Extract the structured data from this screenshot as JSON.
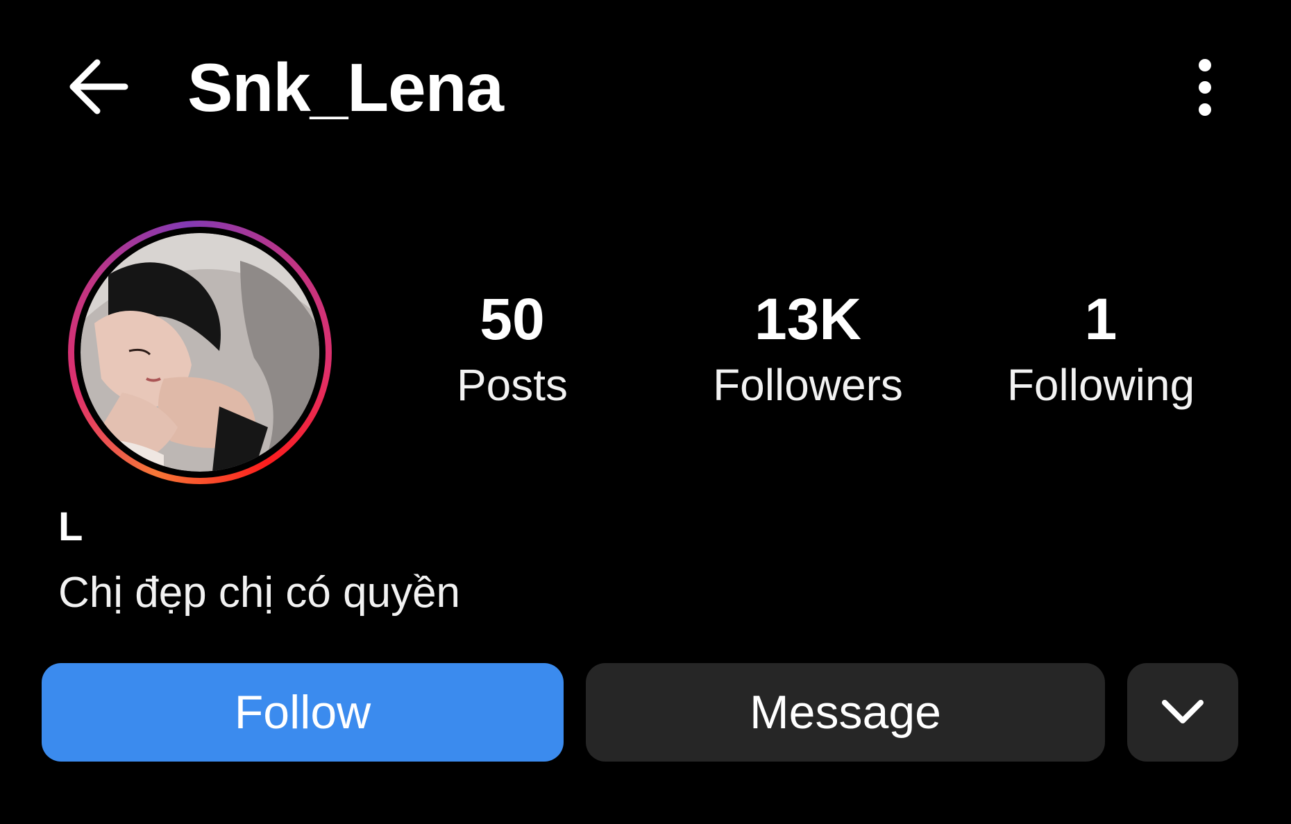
{
  "header": {
    "back_icon": "arrow-left-icon",
    "username": "Snk_Lena",
    "more_icon": "vertical-ellipsis-icon"
  },
  "profile": {
    "avatar_icon": "profile-photo",
    "stats": [
      {
        "value": "50",
        "label": "Posts"
      },
      {
        "value": "13K",
        "label": "Followers"
      },
      {
        "value": "1",
        "label": "Following"
      }
    ],
    "display_name": "L",
    "bio": "Chị đẹp chị có quyền"
  },
  "actions": {
    "follow_label": "Follow",
    "message_label": "Message",
    "suggest_icon": "chevron-down-icon"
  },
  "colors": {
    "background": "#000000",
    "follow_button": "#3b8bee",
    "secondary_button": "#262626",
    "text": "#ffffff"
  }
}
